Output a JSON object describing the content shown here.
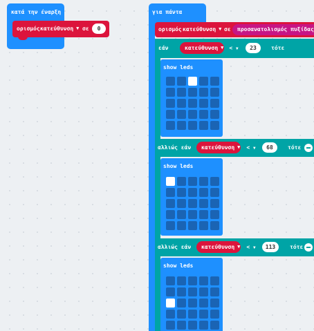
{
  "on_start": {
    "label": "κατά την έναρξη",
    "set_label": "ορισμός",
    "variable": "κατεύθυνση",
    "to_label": "σε",
    "value": "0"
  },
  "forever": {
    "label": "για πάντα",
    "set_label": "ορισμός",
    "variable": "κατεύθυνση",
    "to_label": "σε",
    "compass_label": "προσανατολισμός πυξίδας (°)",
    "if_label": "εάν",
    "then_label": "τότε",
    "else_if_label": "αλλιώς εάν",
    "show_leds_label": "show leds",
    "conditions": [
      {
        "variable": "κατεύθυνση",
        "op": "<",
        "value": "23"
      },
      {
        "variable": "κατεύθυνση",
        "op": "<",
        "value": "68"
      },
      {
        "variable": "κατεύθυνση",
        "op": "<",
        "value": "113"
      }
    ],
    "led_patterns": [
      [
        [
          0,
          0,
          0,
          0,
          0
        ],
        [
          0,
          0,
          0,
          0,
          0
        ],
        [
          0,
          0,
          0,
          0,
          0
        ],
        [
          0,
          0,
          0,
          0,
          0
        ],
        [
          0,
          0,
          0,
          0,
          0
        ],
        [
          0,
          0,
          0,
          0,
          0
        ]
      ],
      [
        [
          1,
          0,
          0,
          0,
          0
        ],
        [
          0,
          0,
          0,
          0,
          0
        ],
        [
          0,
          0,
          0,
          0,
          0
        ],
        [
          0,
          0,
          0,
          0,
          0
        ],
        [
          0,
          0,
          0,
          0,
          0
        ]
      ],
      [
        [
          0,
          0,
          0,
          0,
          0
        ],
        [
          0,
          0,
          0,
          0,
          0
        ],
        [
          1,
          0,
          0,
          0,
          0
        ],
        [
          0,
          0,
          0,
          0,
          0
        ],
        [
          0,
          0,
          0,
          0,
          0
        ]
      ]
    ],
    "first_pattern": [
      [
        0,
        0,
        1,
        0,
        0
      ],
      [
        0,
        0,
        0,
        0,
        0
      ],
      [
        0,
        0,
        0,
        0,
        0
      ],
      [
        0,
        0,
        0,
        0,
        0
      ],
      [
        0,
        0,
        0,
        0,
        0
      ]
    ]
  },
  "colors": {
    "event_blue": "#1e90ff",
    "variable_red": "#dc143c",
    "logic_teal": "#00a4a6",
    "input_magenta": "#c71585"
  }
}
